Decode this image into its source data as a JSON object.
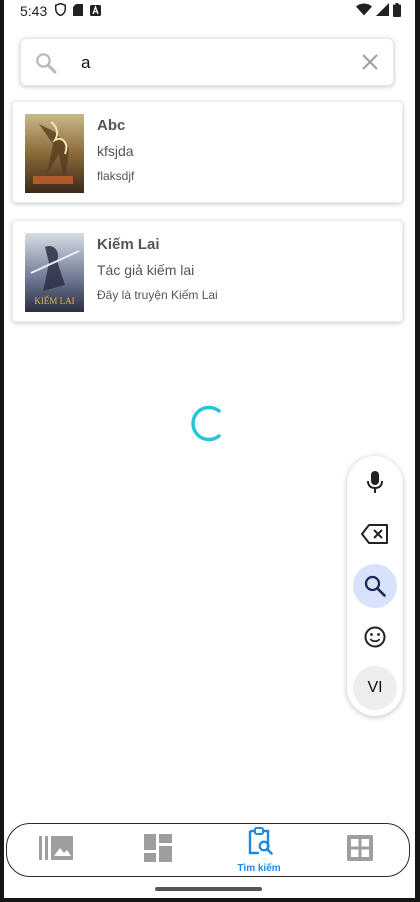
{
  "status_bar": {
    "time": "5:43",
    "left_icons": [
      "shield-icon",
      "sd-card-icon",
      "a-box-icon"
    ],
    "right_icons": [
      "wifi-icon",
      "signal-icon",
      "battery-icon"
    ]
  },
  "search": {
    "value": "a",
    "search_icon": "search-icon",
    "clear_icon": "close-icon"
  },
  "results": [
    {
      "title": "Abc",
      "author": "kfsjda",
      "description": "flaksdjf",
      "cover_text": ""
    },
    {
      "title": "Kiếm Lai",
      "author": "Tác giả kiếm lai",
      "description": "Đây là truyện Kiếm Lai",
      "cover_text": "KIẾM LAI"
    }
  ],
  "loading": {
    "spinner_color": "#26c6da"
  },
  "keyboard_toolbar": {
    "buttons": [
      "mic-icon",
      "backspace-icon",
      "search-icon",
      "emoji-icon"
    ],
    "language_label": "VI",
    "active_color": "#d9e2fb"
  },
  "bottom_nav": {
    "items": [
      {
        "icon": "library-icon",
        "label": ""
      },
      {
        "icon": "dashboard-icon",
        "label": ""
      },
      {
        "icon": "search-clipboard-icon",
        "label": "Tìm kiếm"
      },
      {
        "icon": "grid-icon",
        "label": ""
      }
    ],
    "active_index": 2,
    "active_color": "#1e88e5",
    "inactive_color": "#9e9e9e"
  }
}
